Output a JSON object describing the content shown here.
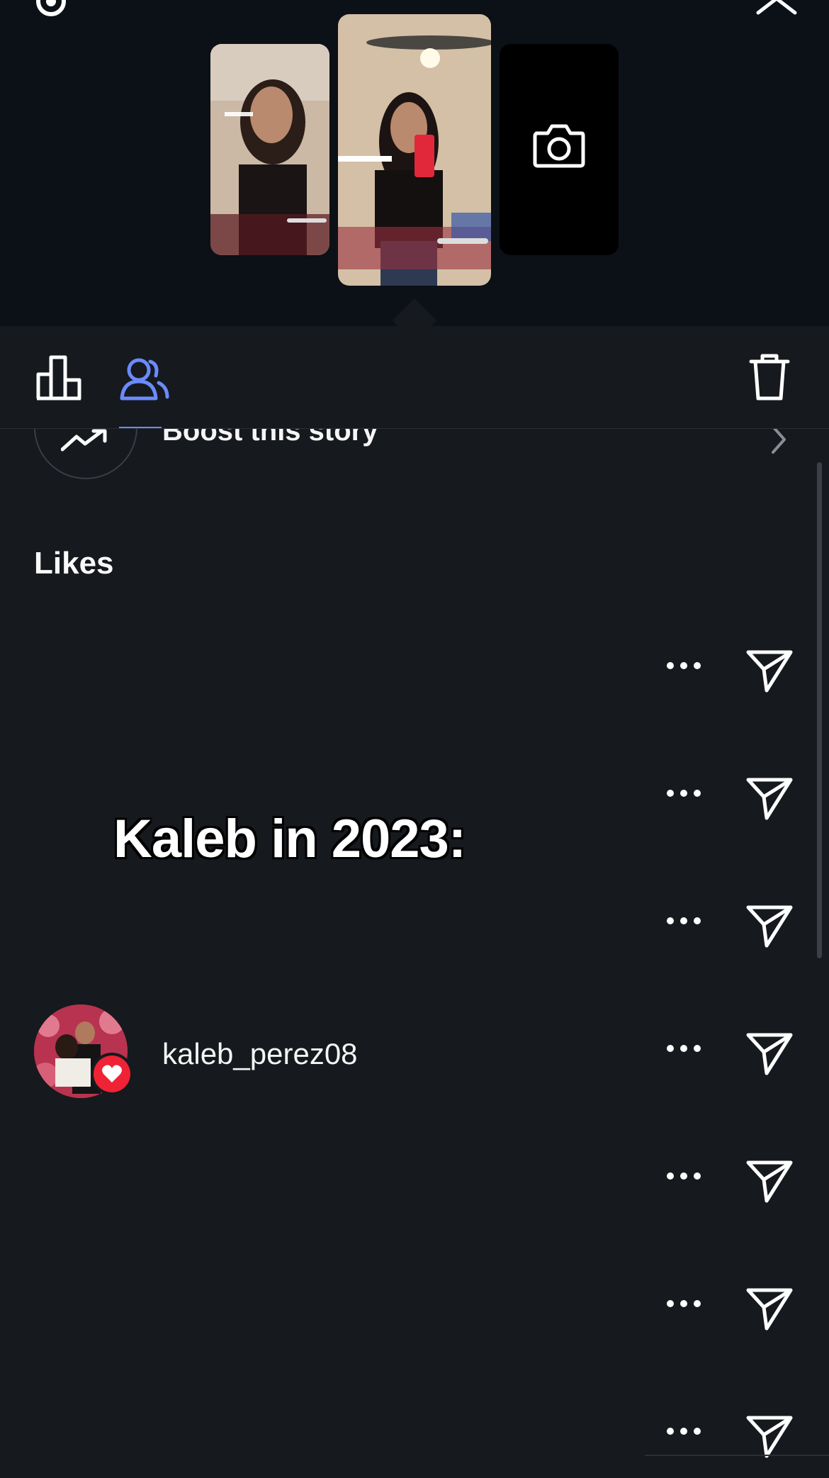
{
  "toolbar": {
    "tabs": [
      {
        "id": "insights",
        "icon": "bar-chart-icon",
        "active": false
      },
      {
        "id": "viewers",
        "icon": "people-icon",
        "active": true
      }
    ],
    "delete_icon": "trash-icon",
    "accent_color": "#6b8afd"
  },
  "boost": {
    "label": "Boost this story",
    "icon": "trending-up-icon"
  },
  "likes": {
    "title": "Likes",
    "overlay_caption": "Kaleb in 2023:",
    "rows": [
      {
        "username": ""
      },
      {
        "username": ""
      },
      {
        "username": ""
      },
      {
        "username": "kaleb_perez08",
        "liked": true
      },
      {
        "username": ""
      },
      {
        "username": ""
      },
      {
        "username": ""
      }
    ]
  },
  "colors": {
    "background": "#16191d",
    "header_background": "#0c1017",
    "like_red": "#ef2335"
  }
}
